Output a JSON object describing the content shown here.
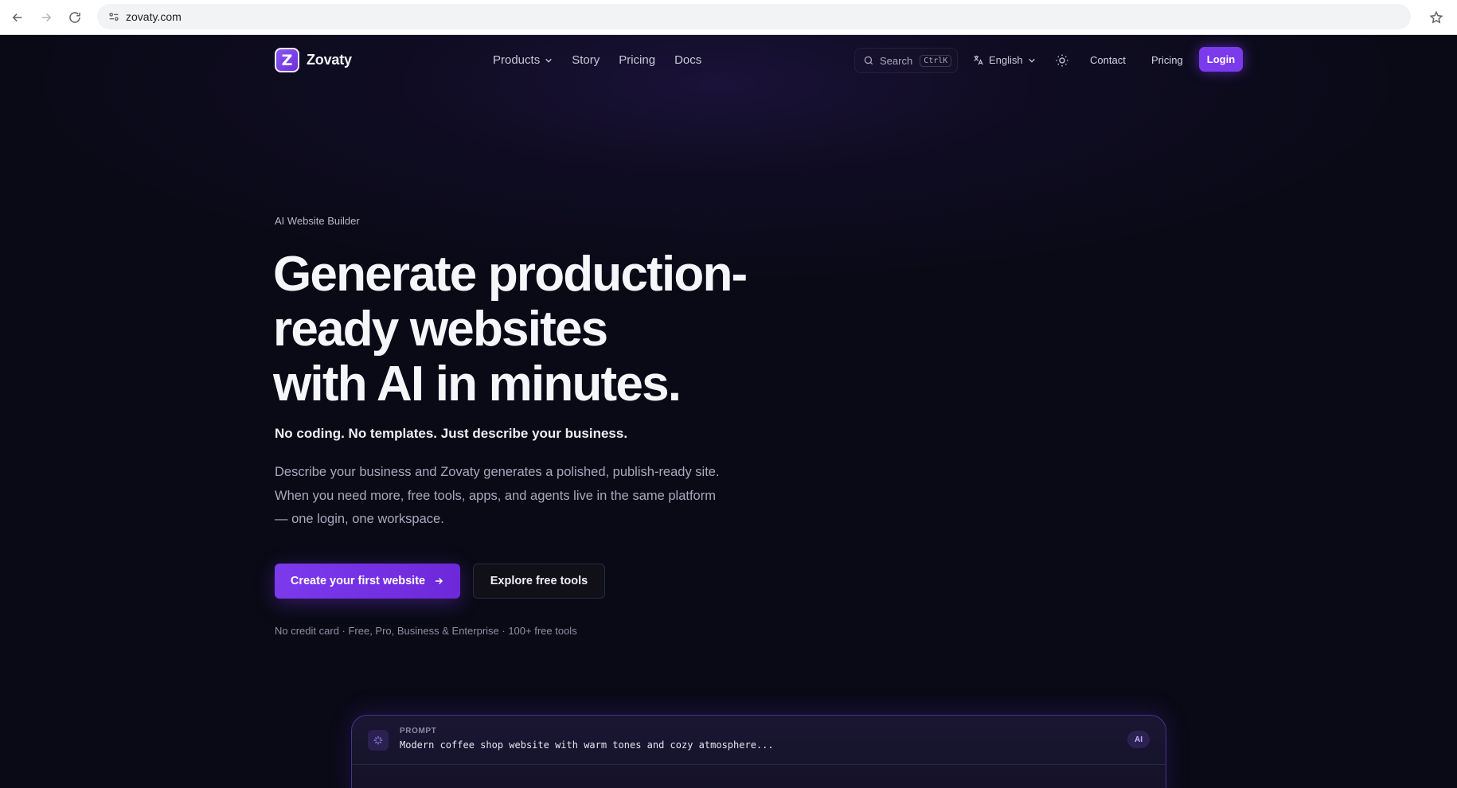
{
  "browser": {
    "url": "zovaty.com"
  },
  "nav": {
    "brand": "Zovaty",
    "logo_letter": "Z",
    "items": [
      "Products",
      "Story",
      "Pricing",
      "Docs"
    ],
    "search_label": "Search",
    "search_shortcut": "CtrlK",
    "language": "English",
    "contact": "Contact",
    "pricing": "Pricing",
    "login": "Login"
  },
  "hero": {
    "eyebrow": "AI Website Builder",
    "headline_line1": "Generate production-",
    "headline_line2": "ready websites",
    "headline_line3": "with AI in minutes.",
    "subhead": "No coding. No templates. Just describe your business.",
    "description": "Describe your business and Zovaty generates a polished, publish-ready site. When you need more, free tools, apps, and agents live in the same platform — one login, one workspace.",
    "primary_cta": "Create your first website",
    "secondary_cta": "Explore free tools",
    "footnote": "No credit card · Free, Pro, Business & Enterprise · 100+ free tools"
  },
  "prompt": {
    "label": "PROMPT",
    "text": "Modern coffee shop website with warm tones and cozy atmosphere...",
    "badge": "AI"
  },
  "colors": {
    "accent": "#7c3aed",
    "background": "#0a0a16"
  },
  "icons": [
    "back-icon",
    "forward-icon",
    "reload-icon",
    "site-info-icon",
    "star-icon",
    "chevron-down-icon",
    "search-icon",
    "translate-icon",
    "sun-icon",
    "arrow-right-icon",
    "sparkle-icon"
  ]
}
